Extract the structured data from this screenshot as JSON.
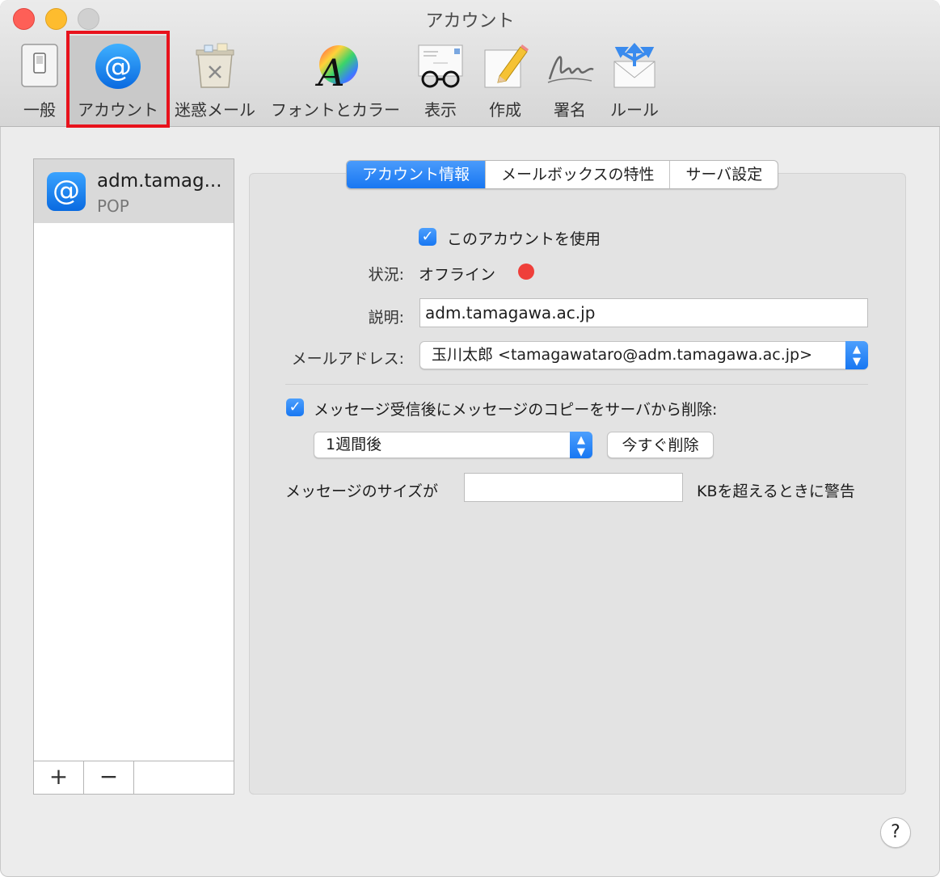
{
  "window": {
    "title": "アカウント"
  },
  "toolbar": {
    "items": [
      {
        "label": "一般",
        "icon": "switch-icon"
      },
      {
        "label": "アカウント",
        "icon": "at-sign-icon",
        "selected": true
      },
      {
        "label": "迷惑メール",
        "icon": "junk-bin-icon"
      },
      {
        "label": "フォントとカラー",
        "icon": "font-color-icon"
      },
      {
        "label": "表示",
        "icon": "glasses-letter-icon"
      },
      {
        "label": "作成",
        "icon": "pencil-paper-icon"
      },
      {
        "label": "署名",
        "icon": "signature-icon"
      },
      {
        "label": "ルール",
        "icon": "rules-envelope-icon"
      }
    ]
  },
  "accounts": {
    "list": [
      {
        "name": "adm.tamag...",
        "type": "POP"
      }
    ],
    "add_label": "+",
    "remove_label": "−"
  },
  "tabs": [
    {
      "label": "アカウント情報",
      "active": true
    },
    {
      "label": "メールボックスの特性",
      "active": false
    },
    {
      "label": "サーバ設定",
      "active": false
    }
  ],
  "form": {
    "use_account_label": "このアカウントを使用",
    "use_account_checked": true,
    "status_label": "状況:",
    "status_value": "オフライン",
    "status_color": "#ef3f3a",
    "description_label": "説明:",
    "description_value": "adm.tamagawa.ac.jp",
    "email_label": "メールアドレス:",
    "email_value": "玉川太郎 <tamagawataro@adm.tamagawa.ac.jp>",
    "delete_copy_label": "メッセージ受信後にメッセージのコピーをサーバから削除:",
    "delete_copy_checked": true,
    "delete_after_value": "1週間後",
    "delete_now_label": "今すぐ削除",
    "size_warn_prefix": "メッセージのサイズが",
    "size_warn_value": "",
    "size_warn_suffix": "KBを超えるときに警告"
  },
  "help_label": "?",
  "colors": {
    "accent": "#1877f2",
    "highlight": "#e8121c"
  }
}
